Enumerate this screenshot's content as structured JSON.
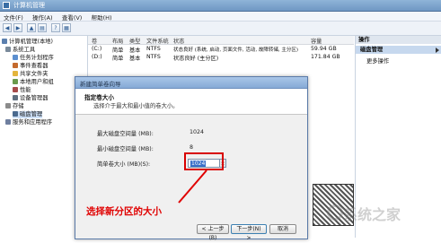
{
  "window": {
    "title": "计算机管理"
  },
  "menubar": [
    "文件(F)",
    "操作(A)",
    "查看(V)",
    "帮助(H)"
  ],
  "tree": {
    "root": "计算机管理(本地)",
    "items": [
      {
        "label": "系统工具",
        "level": 1
      },
      {
        "label": "任务计划程序",
        "level": 2
      },
      {
        "label": "事件查看器",
        "level": 2
      },
      {
        "label": "共享文件夹",
        "level": 2
      },
      {
        "label": "本地用户和组",
        "level": 2
      },
      {
        "label": "性能",
        "level": 2
      },
      {
        "label": "设备管理器",
        "level": 2
      },
      {
        "label": "存储",
        "level": 1
      },
      {
        "label": "磁盘管理",
        "level": 2,
        "selected": true
      },
      {
        "label": "服务和应用程序",
        "level": 1
      }
    ]
  },
  "volumes": {
    "columns": [
      "卷",
      "布局",
      "类型",
      "文件系统",
      "状态",
      "容量"
    ],
    "rows": [
      {
        "volume": "(C:)",
        "layout": "简单",
        "type": "基本",
        "fs": "NTFS",
        "status": "状态良好 (系统, 启动, 页面文件, 活动, 故障转储, 主分区)",
        "capacity": "59.94 GB"
      },
      {
        "volume": "(D:)",
        "layout": "简单",
        "type": "基本",
        "fs": "NTFS",
        "status": "状态良好 (主分区)",
        "capacity": "171.84 GB"
      }
    ]
  },
  "actions": {
    "header": "操作",
    "section": "磁盘管理",
    "more": "更多操作"
  },
  "wizard": {
    "title": "新建简单卷向导",
    "heading": "指定卷大小",
    "subheading": "选择介于最大和最小值的卷大小。",
    "max_label": "最大磁盘空间量 (MB):",
    "max_value": "1024",
    "min_label": "最小磁盘空间量 (MB):",
    "min_value": "8",
    "size_label": "简单卷大小 (MB)(S):",
    "size_value": "1024",
    "annotation": "选择新分区的大小",
    "buttons": {
      "back": "< 上一步(B)",
      "next": "下一步(N) >",
      "cancel": "取消"
    }
  },
  "watermark": "系统之家",
  "colors": {
    "annotation": "#e00000",
    "selection": "#3a70c9",
    "titlebar": "#6f97c3"
  }
}
